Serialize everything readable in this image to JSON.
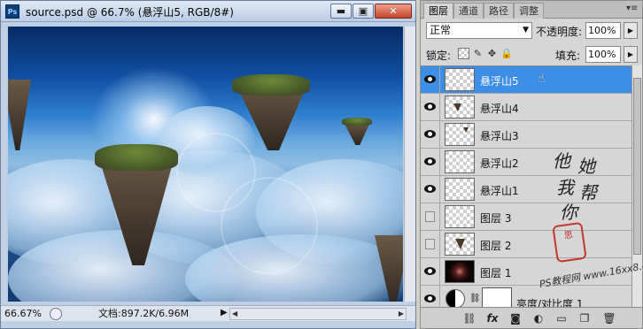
{
  "document": {
    "title": "source.psd @ 66.7% (悬浮山5, RGB/8#)",
    "app_icon": "Ps",
    "window_buttons": {
      "minimize": "▬",
      "maximize": "▣",
      "close": "✕"
    },
    "zoom": "66.67%",
    "doc_size": "文档:897.2K/6.96M",
    "status_arrow": "▶"
  },
  "layers_panel": {
    "tabs": [
      {
        "label": "图层",
        "active": true
      },
      {
        "label": "通道",
        "active": false
      },
      {
        "label": "路径",
        "active": false
      },
      {
        "label": "调整",
        "active": false
      }
    ],
    "blend_mode": "正常",
    "opacity_label": "不透明度:",
    "opacity_value": "100%",
    "lock_label": "锁定:",
    "fill_label": "填充:",
    "fill_value": "100%",
    "layers": [
      {
        "name": "悬浮山5",
        "visible": true,
        "selected": true
      },
      {
        "name": "悬浮山4",
        "visible": true,
        "selected": false
      },
      {
        "name": "悬浮山3",
        "visible": true,
        "selected": false
      },
      {
        "name": "悬浮山2",
        "visible": true,
        "selected": false
      },
      {
        "name": "悬浮山1",
        "visible": true,
        "selected": false
      },
      {
        "name": "图层 3",
        "visible": false,
        "selected": false
      },
      {
        "name": "图层 2",
        "visible": false,
        "selected": false
      },
      {
        "name": "图层 1",
        "visible": true,
        "selected": false
      },
      {
        "name": "亮度/对比度 1",
        "visible": true,
        "selected": false
      }
    ],
    "footer_icons": [
      "link-layers-icon",
      "fx-icon",
      "add-mask-icon",
      "adjustment-layer-icon",
      "new-group-icon",
      "new-layer-icon",
      "delete-layer-icon"
    ]
  },
  "watermark": {
    "chars": [
      "他",
      "她",
      "我",
      "帮",
      "你"
    ],
    "seal": "思",
    "url": "PS教程网 www.16xx8.com"
  },
  "colors": {
    "selection": "#3d8ee6",
    "panel_bg": "#d6d6d6",
    "window_frame": "#bfcfe4"
  }
}
